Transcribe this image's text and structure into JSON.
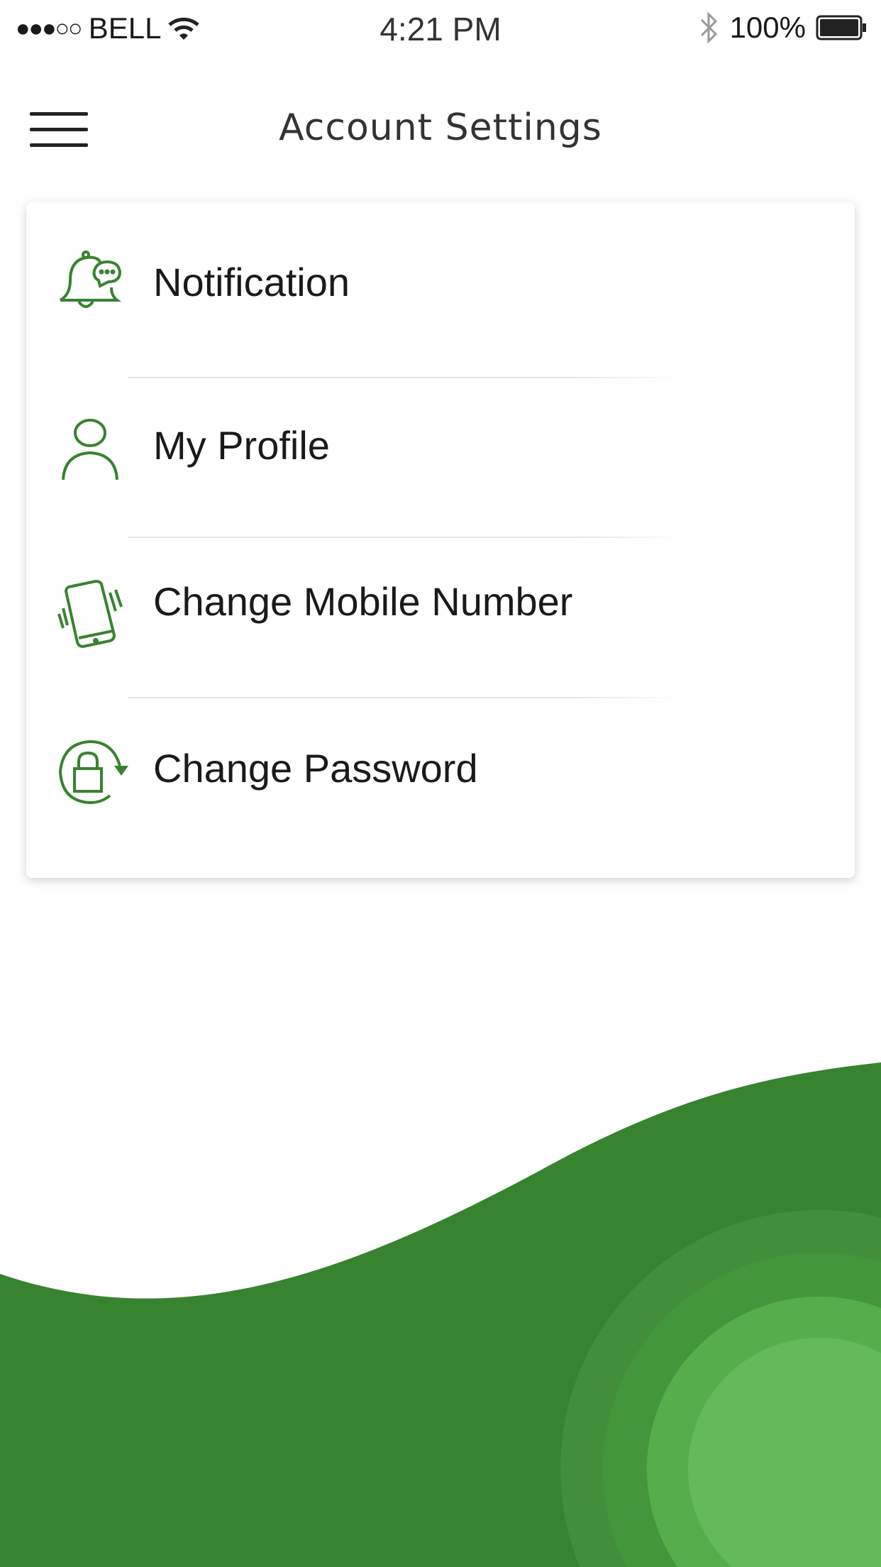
{
  "status_bar": {
    "carrier": "BELL",
    "signal": "●●●○○",
    "time": "4:21 PM",
    "battery": "100%"
  },
  "header": {
    "title": "Account Settings",
    "menu_icon": "hamburger-icon"
  },
  "settings": [
    {
      "label": "Notification",
      "icon": "bell-chat-icon"
    },
    {
      "label": "My Profile",
      "icon": "user-icon"
    },
    {
      "label": "Change Mobile Number",
      "icon": "vibrating-phone-icon"
    },
    {
      "label": "Change Password",
      "icon": "lock-refresh-icon"
    }
  ],
  "colors": {
    "accent": "#37832f",
    "wave": "#37832f",
    "ring1": "#428e3a",
    "ring2": "#43963b",
    "ring3": "#56ad4c",
    "ring4": "#64b95a"
  }
}
